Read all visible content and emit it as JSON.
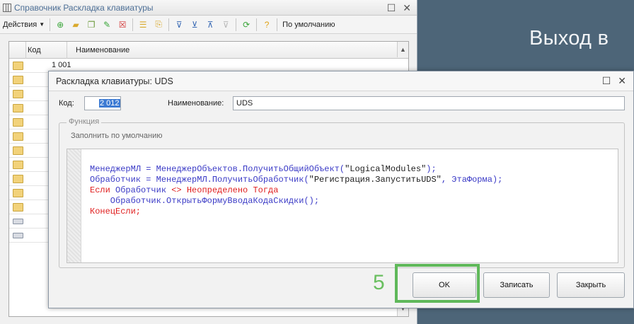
{
  "slide": {
    "title": "Выход в"
  },
  "back_window": {
    "title": "Справочник Раскладка клавиатуры",
    "toolbar": {
      "actions_label": "Действия",
      "default_label": "По умолчанию"
    },
    "grid": {
      "columns": [
        "Код",
        "Наименование"
      ],
      "first_row_code": "1 001"
    }
  },
  "dialog": {
    "title": "Раскладка клавиатуры: UDS",
    "code_label": "Код:",
    "code_value": "2 012",
    "name_label": "Наименование:",
    "name_value": "UDS",
    "group_title": "Функция",
    "fill_default_link": "Заполнить по умолчанию",
    "code_lines": [
      "МенеджерМЛ = МенеджерОбъектов.ПолучитьОбщийОбъект(\"LogicalModules\");",
      "Обработчик = МенеджерМЛ.ПолучитьОбработчик(\"Регистрация.ЗапуститьUDS\", ЭтаФорма);",
      "Если Обработчик <> Неопределено Тогда",
      "    Обработчик.ОткрытьФормуВводаКодаСкидки();",
      "КонецЕсли;"
    ],
    "buttons": {
      "ok": "OK",
      "save": "Записать",
      "close": "Закрыть"
    }
  },
  "annotation": {
    "step_number": "5",
    "highlight_color": "#5fb85a"
  }
}
